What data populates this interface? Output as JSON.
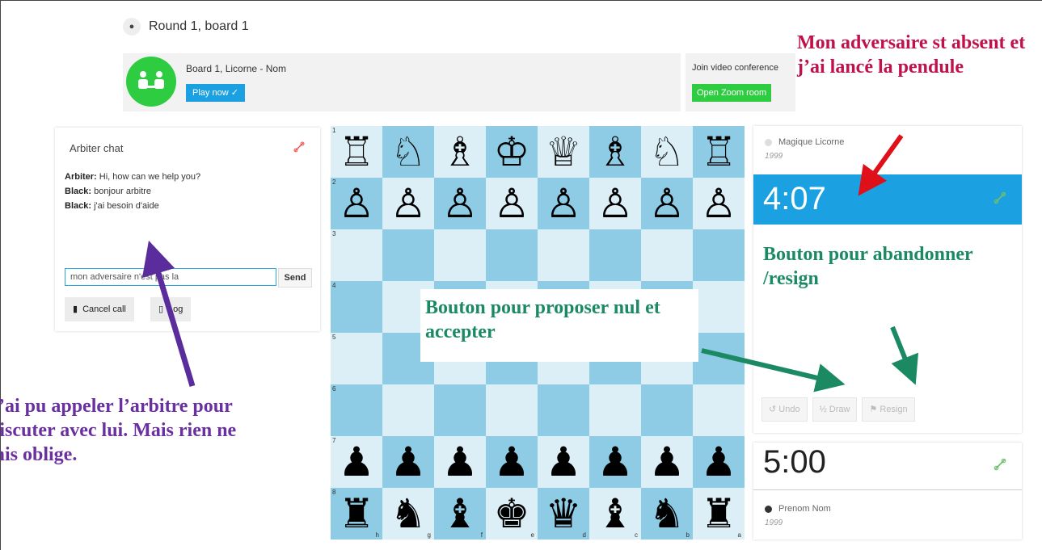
{
  "breadcrumb": {
    "text": "Round 1, board 1",
    "icon": "home-icon"
  },
  "board_card": {
    "title": "Board 1, Licorne - Nom",
    "play_button": "Play now ✓"
  },
  "zoom_card": {
    "title": "Join video conference",
    "button": "Open Zoom room"
  },
  "chat": {
    "heading": "Arbiter chat",
    "messages": [
      {
        "sender": "Arbiter:",
        "text": "Hi, how can we help you?"
      },
      {
        "sender": "Black:",
        "text": "bonjour arbitre"
      },
      {
        "sender": "Black:",
        "text": "j'ai besoin d'aide"
      }
    ],
    "input_value": "mon adversaire n'est pas la",
    "send_label": "Send",
    "cancel_call_label": "Cancel call",
    "log_label": "Log"
  },
  "board": {
    "ranks": [
      "1",
      "2",
      "3",
      "4",
      "5",
      "6",
      "7",
      "8"
    ],
    "files": [
      "h",
      "g",
      "f",
      "e",
      "d",
      "c",
      "b",
      "a"
    ],
    "rows": [
      [
        "♖",
        "♘",
        "♗",
        "♔",
        "♕",
        "♗",
        "♘",
        "♖"
      ],
      [
        "♙",
        "♙",
        "♙",
        "♙",
        "♙",
        "♙",
        "♙",
        "♙"
      ],
      [
        "",
        "",
        "",
        "",
        "",
        "",
        "",
        ""
      ],
      [
        "",
        "",
        "",
        "",
        "",
        "",
        "",
        ""
      ],
      [
        "",
        "",
        "",
        "",
        "",
        "",
        "",
        ""
      ],
      [
        "",
        "",
        "",
        "",
        "",
        "",
        "",
        ""
      ],
      [
        "♟",
        "♟",
        "♟",
        "♟",
        "♟",
        "♟",
        "♟",
        "♟"
      ],
      [
        "♜",
        "♞",
        "♝",
        "♚",
        "♛",
        "♝",
        "♞",
        "♜"
      ]
    ],
    "light_color": "#dceff7",
    "dark_color": "#8ecbe4"
  },
  "opponent": {
    "name": "Magique Licorne",
    "rating": "1999",
    "clock": "4:07"
  },
  "player": {
    "name": "Prenom Nom",
    "rating": "1999",
    "clock": "5:00"
  },
  "actions": {
    "undo": "Undo",
    "draw": "½ Draw",
    "resign": "Resign"
  },
  "annotations": {
    "red": "Mon adversaire st absent et j’ai lancé la pendule",
    "green_resign": "Bouton pour abandonner /resign",
    "green_draw": "Bouton pour proposer nul et accepter",
    "purple": "J’ai pu appeler l’arbitre pour discuter avec lui. Mais rien ne mis oblige."
  },
  "colors": {
    "accent_blue": "#1ba1e2",
    "accent_green": "#2ecc40",
    "annotation_red": "#c0124a",
    "annotation_green": "#1b8a63",
    "annotation_purple": "#6a2fa0"
  }
}
